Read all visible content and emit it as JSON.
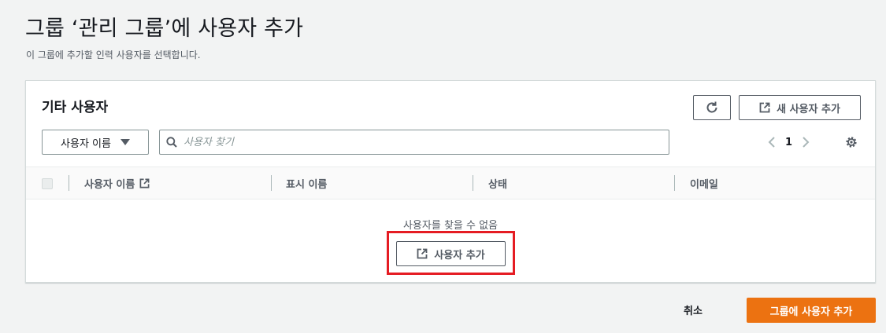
{
  "page": {
    "title": "그룹 ‘관리 그룹’에 사용자 추가",
    "description": "이 그룹에 추가할 인력 사용자를 선택합니다."
  },
  "panel": {
    "title": "기타 사용자",
    "refresh_icon": "refresh-icon",
    "new_user_label": "새 사용자 추가",
    "filter_select_value": "사용자 이름",
    "search_placeholder": "사용자 찾기",
    "pager": {
      "current_page": "1"
    },
    "columns": [
      "사용자 이름",
      "표시 이름",
      "상태",
      "이메일"
    ],
    "empty_text": "사용자를 찾을 수 없음",
    "add_user_label": "사용자 추가"
  },
  "footer": {
    "cancel_label": "취소",
    "submit_label": "그룹에 사용자 추가"
  },
  "colors": {
    "primary": "#ec7211",
    "highlight": "#e51c23",
    "background": "#f2f3f3"
  }
}
